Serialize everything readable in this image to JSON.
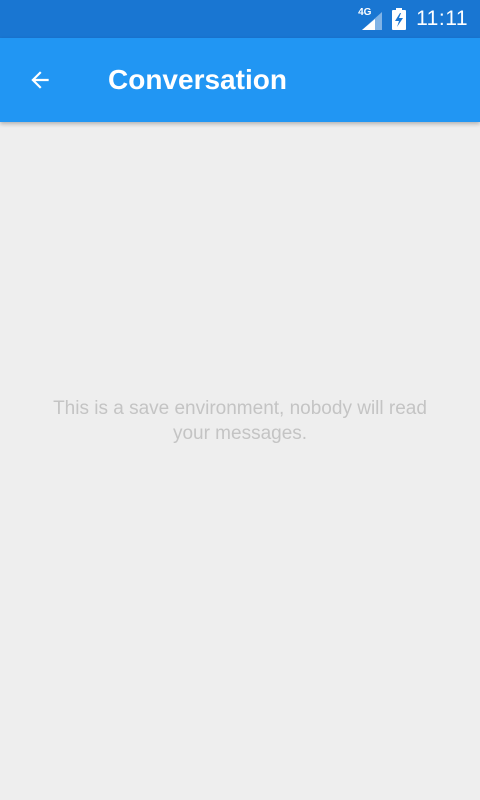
{
  "status_bar": {
    "network_label": "4G",
    "time": "11:11",
    "background_color": "#1976d2",
    "icons": [
      "signal-icon",
      "battery-charging-icon"
    ]
  },
  "app_bar": {
    "title": "Conversation",
    "background_color": "#2196f3",
    "back_icon": "arrow-back-icon"
  },
  "main": {
    "empty_message": "This is a save environment, nobody will read your messages.",
    "background_color": "#eeeeee",
    "message_color": "#c4c4c4"
  }
}
